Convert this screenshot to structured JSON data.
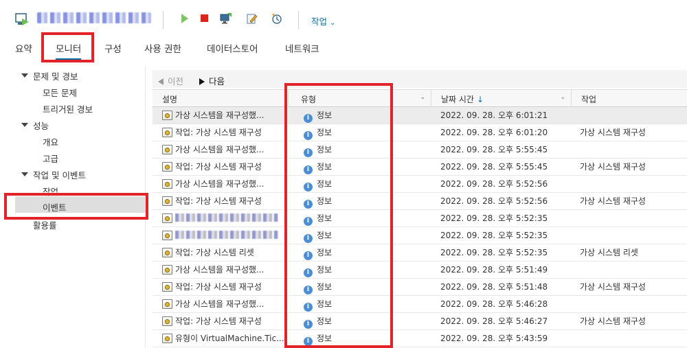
{
  "header": {
    "vm_name": "■■■■■■■■",
    "actions_label": "작업"
  },
  "tabs": [
    {
      "label": "요약"
    },
    {
      "label": "모니터"
    },
    {
      "label": "구성"
    },
    {
      "label": "사용 권한"
    },
    {
      "label": "데이터스토어"
    },
    {
      "label": "네트워크"
    }
  ],
  "active_tab": "모니터",
  "sidebar": {
    "sections": [
      {
        "label": "문제 및 경보",
        "items": [
          "모든 문제",
          "트리거된 경보"
        ]
      },
      {
        "label": "성능",
        "items": [
          "개요",
          "고급"
        ]
      },
      {
        "label": "작업 및 이벤트",
        "items": [
          "작업",
          "이벤트"
        ]
      }
    ],
    "utilization": "활용률",
    "selected": "이벤트"
  },
  "nav": {
    "prev": "이전",
    "next": "다음"
  },
  "grid": {
    "columns": [
      "설명",
      "유형",
      "날짜 시간",
      "작업"
    ],
    "sort_column": "날짜 시간",
    "sort_direction": "desc",
    "rows": [
      {
        "desc": "가상 시스템을 재구성했...",
        "type": "정보",
        "date": "2022. 09. 28. 오후 6:01:21",
        "task": ""
      },
      {
        "desc": "작업: 가상 시스템 재구성",
        "type": "정보",
        "date": "2022. 09. 28. 오후 6:01:20",
        "task": "가상 시스템 재구성"
      },
      {
        "desc": "가상 시스템을 재구성했...",
        "type": "정보",
        "date": "2022. 09. 28. 오후 5:55:45",
        "task": ""
      },
      {
        "desc": "작업: 가상 시스템 재구성",
        "type": "정보",
        "date": "2022. 09. 28. 오후 5:55:45",
        "task": "가상 시스템 재구성"
      },
      {
        "desc": "가상 시스템을 재구성했...",
        "type": "정보",
        "date": "2022. 09. 28. 오후 5:52:56",
        "task": ""
      },
      {
        "desc": "작업: 가상 시스템 재구성",
        "type": "정보",
        "date": "2022. 09. 28. 오후 5:52:56",
        "task": "가상 시스템 재구성"
      },
      {
        "desc": "",
        "type": "정보",
        "date": "2022. 09. 28. 오후 5:52:35",
        "task": ""
      },
      {
        "desc": "",
        "type": "정보",
        "date": "2022. 09. 28. 오후 5:52:35",
        "task": ""
      },
      {
        "desc": "작업: 가상 시스템 리셋",
        "type": "정보",
        "date": "2022. 09. 28. 오후 5:52:35",
        "task": "가상 시스템 리셋"
      },
      {
        "desc": "가상 시스템을 재구성했...",
        "type": "정보",
        "date": "2022. 09. 28. 오후 5:51:49",
        "task": ""
      },
      {
        "desc": "작업: 가상 시스템 재구성",
        "type": "정보",
        "date": "2022. 09. 28. 오후 5:51:48",
        "task": "가상 시스템 재구성"
      },
      {
        "desc": "가상 시스템을 재구성했...",
        "type": "정보",
        "date": "2022. 09. 28. 오후 5:46:28",
        "task": ""
      },
      {
        "desc": "작업: 가상 시스템 재구성",
        "type": "정보",
        "date": "2022. 09. 28. 오후 5:46:27",
        "task": "가상 시스템 재구성"
      },
      {
        "desc": "유형이 VirtualMachine.Tic...",
        "type": "정보",
        "date": "2022. 09. 28. 오후 5:43:59",
        "task": ""
      }
    ]
  },
  "colors": {
    "accent": "#0072a3",
    "highlight_box": "#e2232a",
    "info": "#4a8fd6"
  }
}
